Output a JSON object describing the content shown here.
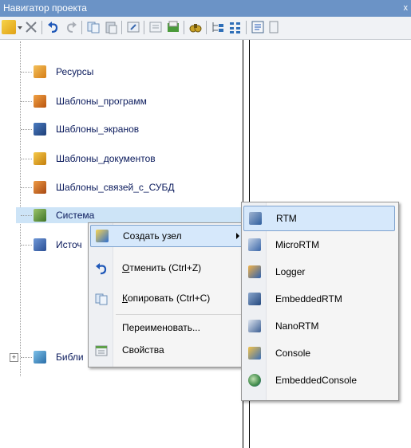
{
  "window": {
    "title": "Навигатор проекта",
    "close_glyph": "x"
  },
  "toolbar": {
    "buttons": [
      "new-node-icon",
      "delete-icon",
      "undo-icon",
      "redo-icon",
      "copy-icon",
      "paste-icon",
      "move-icon",
      "properties-icon",
      "open-folder-icon",
      "find-icon",
      "tree-expand-icon",
      "tree-collapse-icon",
      "list-icon",
      "more-icon"
    ]
  },
  "tree": {
    "items": [
      {
        "label": "Ресурсы",
        "icon": "resources-icon",
        "color": "#e8a030"
      },
      {
        "label": "Шаблоны_программ",
        "icon": "program-templates-icon",
        "color": "#e07b1e"
      },
      {
        "label": "Шаблоны_экранов",
        "icon": "screen-templates-icon",
        "color": "#2f5f9e"
      },
      {
        "label": "Шаблоны_документов",
        "icon": "document-templates-icon",
        "color": "#d89a18"
      },
      {
        "label": "Шаблоны_связей_с_СУБД",
        "icon": "dbms-templates-icon",
        "color": "#c8601a"
      },
      {
        "label": "Система",
        "icon": "system-icon",
        "color": "#5b8a3a"
      },
      {
        "label": "Источ",
        "icon": "sources-icon",
        "color": "#4a6fb5"
      },
      {
        "label": "Библи",
        "icon": "library-icon",
        "color": "#3c8cc4"
      }
    ],
    "expander": "+"
  },
  "context_menu": {
    "create_node": "Создать узел",
    "undo": "Отменить (Ctrl+Z)",
    "undo_key": "О",
    "undo_rest": "тменить (Ctrl+Z)",
    "copy_key": "К",
    "copy_rest": "опировать (Ctrl+C)",
    "rename": "Переименовать...",
    "properties": "Свойства"
  },
  "submenu": {
    "items": [
      "RTM",
      "MicroRTM",
      "Logger",
      "EmbeddedRTM",
      "NanoRTM",
      "Console",
      "EmbeddedConsole"
    ]
  },
  "colors": {
    "accent": "#6b93c6",
    "highlight": "#d6e8fb",
    "selection": "#cde4f7"
  }
}
